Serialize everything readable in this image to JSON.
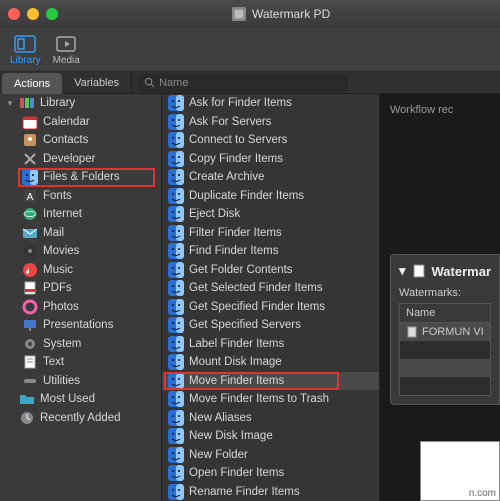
{
  "window_title": "Watermark PD",
  "toolbar": {
    "library": "Library",
    "media": "Media"
  },
  "tabs": {
    "actions": "Actions",
    "variables": "Variables"
  },
  "search_placeholder": "Name",
  "library_root": "Library",
  "categories": [
    {
      "label": "Calendar"
    },
    {
      "label": "Contacts"
    },
    {
      "label": "Developer"
    },
    {
      "label": "Files & Folders",
      "highlight": true
    },
    {
      "label": "Fonts"
    },
    {
      "label": "Internet"
    },
    {
      "label": "Mail"
    },
    {
      "label": "Movies"
    },
    {
      "label": "Music"
    },
    {
      "label": "PDFs"
    },
    {
      "label": "Photos"
    },
    {
      "label": "Presentations"
    },
    {
      "label": "System"
    },
    {
      "label": "Text"
    },
    {
      "label": "Utilities"
    }
  ],
  "most_used": "Most Used",
  "recently_added": "Recently Added",
  "actions": [
    "Ask for Finder Items",
    "Ask For Servers",
    "Connect to Servers",
    "Copy Finder Items",
    "Create Archive",
    "Duplicate Finder Items",
    "Eject Disk",
    "Filter Finder Items",
    "Find Finder Items",
    "Get Folder Contents",
    "Get Selected Finder Items",
    "Get Specified Finder Items",
    "Get Specified Servers",
    "Label Finder Items",
    "Mount Disk Image",
    "Move Finder Items",
    "Move Finder Items to Trash",
    "New Aliases",
    "New Disk Image",
    "New Folder",
    "Open Finder Items",
    "Rename Finder Items"
  ],
  "action_highlight_index": 15,
  "workflow_label": "Workflow rec",
  "panel": {
    "title": "Watermar",
    "sub": "Watermarks:",
    "col": "Name",
    "row": "FORMUN VI"
  },
  "watermark": "n.com"
}
